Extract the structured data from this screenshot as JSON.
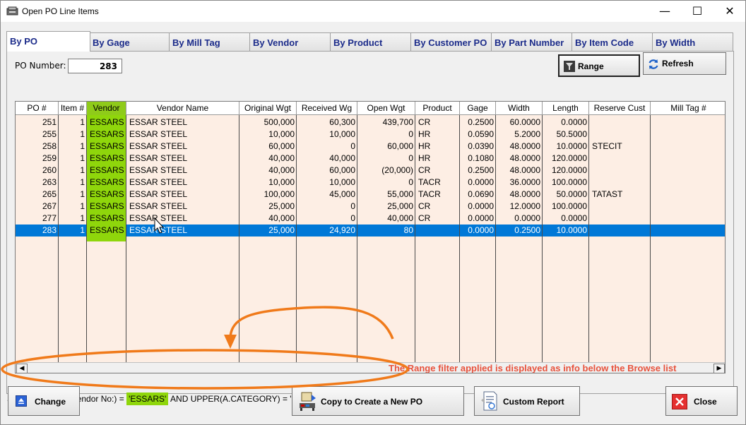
{
  "window": {
    "title": "Open PO Line Items",
    "controls": {
      "minimize": "—",
      "maximize": "☐",
      "close": "✕"
    }
  },
  "tabs": [
    {
      "label": "By PO",
      "active": true
    },
    {
      "label": "By Gage"
    },
    {
      "label": "By Mill Tag"
    },
    {
      "label": "By Vendor"
    },
    {
      "label": "By Product"
    },
    {
      "label": "By Customer PO"
    },
    {
      "label": "By Part Number"
    },
    {
      "label": "By Item Code"
    },
    {
      "label": "By Width"
    }
  ],
  "po_filter": {
    "label": "PO Number:",
    "value": "283"
  },
  "toolbar": {
    "range_label": "Range",
    "refresh_label": "Refresh"
  },
  "grid": {
    "columns": [
      "PO #",
      "Item #",
      "Vendor",
      "Vendor Name",
      "Original Wgt",
      "Received Wg",
      "Open Wgt",
      "Product",
      "Gage",
      "Width",
      "Length",
      "Reserve Cust",
      "Mill Tag #"
    ],
    "rows": [
      [
        "251",
        "1",
        "ESSARS",
        "ESSAR STEEL",
        "500,000",
        "60,300",
        "439,700",
        "CR",
        "0.2500",
        "60.0000",
        "0.0000",
        "",
        ""
      ],
      [
        "255",
        "1",
        "ESSARS",
        "ESSAR STEEL",
        "10,000",
        "10,000",
        "0",
        "HR",
        "0.0590",
        "5.2000",
        "50.5000",
        "",
        ""
      ],
      [
        "258",
        "1",
        "ESSARS",
        "ESSAR STEEL",
        "60,000",
        "0",
        "60,000",
        "HR",
        "0.0390",
        "48.0000",
        "10.0000",
        "STECIT",
        ""
      ],
      [
        "259",
        "1",
        "ESSARS",
        "ESSAR STEEL",
        "40,000",
        "40,000",
        "0",
        "HR",
        "0.1080",
        "48.0000",
        "120.0000",
        "",
        ""
      ],
      [
        "260",
        "1",
        "ESSARS",
        "ESSAR STEEL",
        "40,000",
        "60,000",
        "(20,000)",
        "CR",
        "0.2500",
        "48.0000",
        "120.0000",
        "",
        ""
      ],
      [
        "263",
        "1",
        "ESSARS",
        "ESSAR STEEL",
        "10,000",
        "10,000",
        "0",
        "TACR",
        "0.0000",
        "36.0000",
        "100.0000",
        "",
        ""
      ],
      [
        "265",
        "1",
        "ESSARS",
        "ESSAR STEEL",
        "100,000",
        "45,000",
        "55,000",
        "TACR",
        "0.0690",
        "48.0000",
        "50.0000",
        "TATAST",
        ""
      ],
      [
        "267",
        "1",
        "ESSARS",
        "ESSAR STEEL",
        "25,000",
        "0",
        "25,000",
        "CR",
        "0.0000",
        "12.0000",
        "100.0000",
        "",
        ""
      ],
      [
        "277",
        "1",
        "ESSARS",
        "ESSAR STEEL",
        "40,000",
        "0",
        "40,000",
        "CR",
        "0.0000",
        "0.0000",
        "0.0000",
        "",
        ""
      ],
      [
        "283",
        "1",
        "ESSARS",
        "ESSAR STEEL",
        "25,000",
        "24,920",
        "80",
        "",
        "0.0000",
        "0.2500",
        "10.0000",
        "",
        ""
      ]
    ],
    "selected_row": 9
  },
  "annotation": "The Range filter applied is displayed as info below the Browse list",
  "sql_filter": {
    "prefix": "SQL( UPPER(A.   Vendor No:) = ",
    "highlight": "'ESSARS'",
    "suffix": " AND UPPER(A.CATEGORY) = 'P' AND A.Status <> 'C')"
  },
  "actions": {
    "change_label": "Change",
    "copy_label": "Copy to Create a New PO",
    "custom_report_label": "Custom Report",
    "close_label": "Close"
  },
  "colors": {
    "grid_bg": "#fdeee4",
    "selection": "#0078d7",
    "highlight_green": "#8fd60b",
    "annotation_orange": "#f07a1a",
    "annotation_text": "#e8523c",
    "tab_text": "#1b2b8a"
  }
}
